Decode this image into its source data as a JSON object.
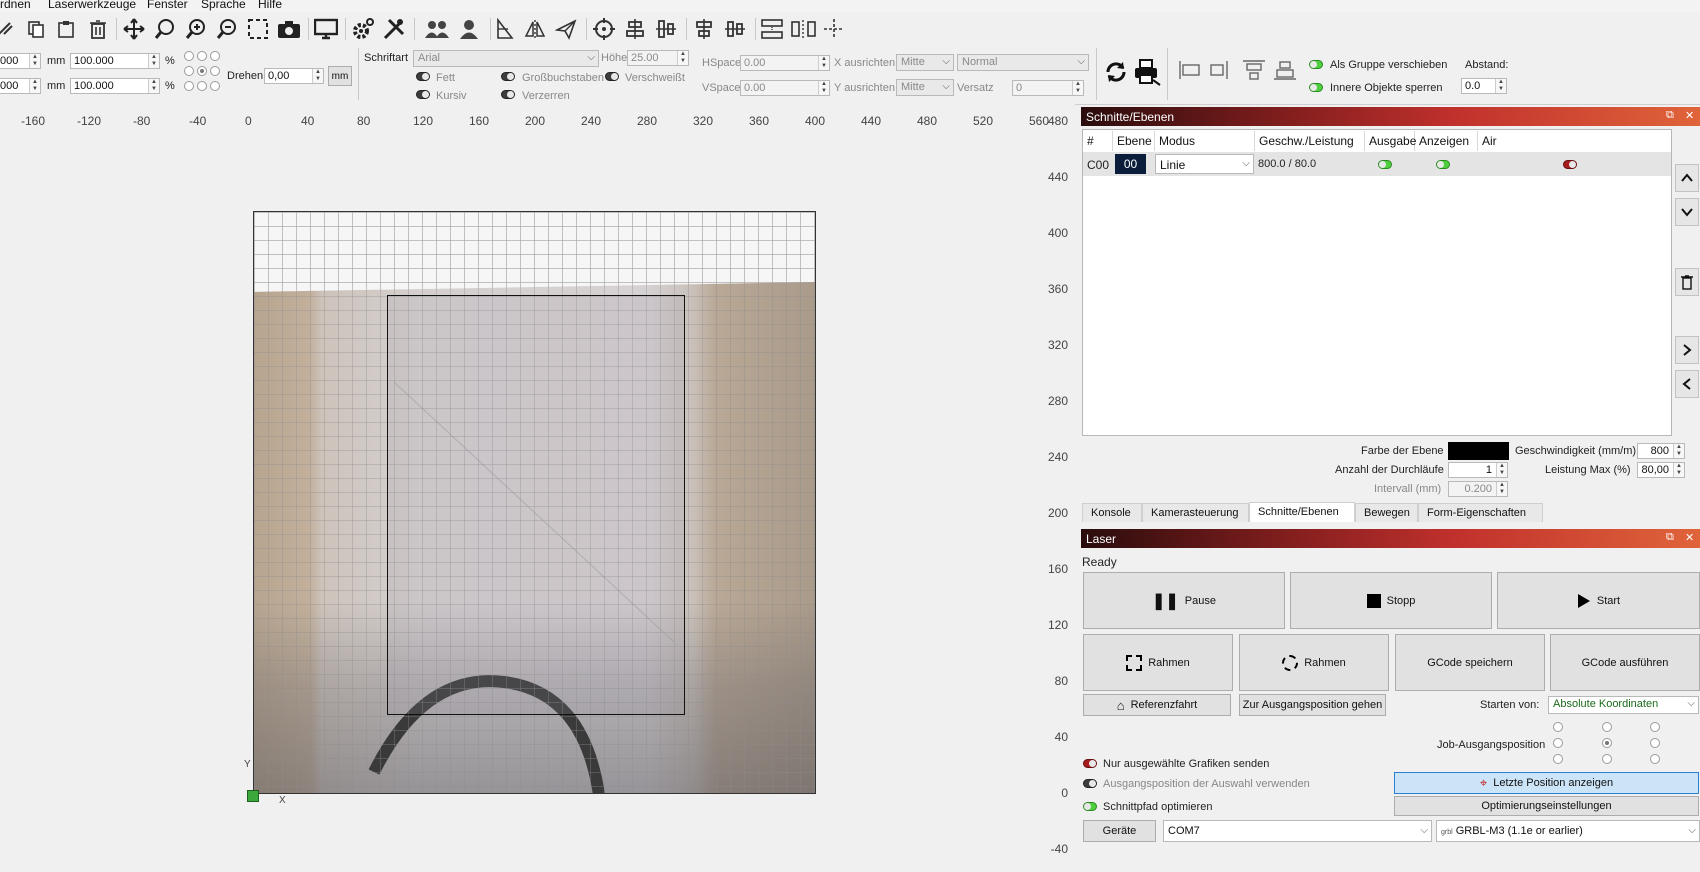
{
  "menu": [
    "rdnen",
    "Laserwerkzeuge",
    "Fenster",
    "Sprache",
    "Hilfe"
  ],
  "toolbar_icons": [
    "cut-icon",
    "copy-icon",
    "paste-icon",
    "delete-icon",
    "move-icon",
    "zoom-page-icon",
    "zoom-in-icon",
    "zoom-out-icon",
    "select-frame-icon",
    "camera-icon",
    "monitor-icon",
    "settings-icon",
    "tools-icon",
    "group-icon",
    "user-icon",
    "align-icon",
    "mirror-icon",
    "send-icon",
    "target-icon",
    "distribute-icon",
    "center-icon",
    "align-vert-icon",
    "align-horz-icon",
    "spacing-icon",
    "spacing2-icon",
    "crosshair-icon"
  ],
  "props": {
    "pos_x": "000",
    "pos_y": "000",
    "unit_mm": "mm",
    "width": "100.000",
    "height": "100.000",
    "pct": "%",
    "drehen_label": "Drehen",
    "drehen_value": "0,00",
    "mm_button": "mm",
    "schriftart_label": "Schriftart",
    "font_value": "Arial",
    "hoehe_label": "Höhe",
    "hoehe_value": "25.00",
    "fett": "Fett",
    "kursiv": "Kursiv",
    "gross": "Großbuchstaben",
    "verzerren": "Verzerren",
    "verschweisst": "Verschweißt",
    "hspace_label": "HSpace",
    "hspace_value": "0.00",
    "vspace_label": "VSpace",
    "vspace_value": "0.00",
    "x_ausrichten_label": "X ausrichten",
    "x_ausrichten_value": "Mitte",
    "normal_value": "Normal",
    "y_ausrichten_label": "Y ausrichten",
    "y_ausrichten_value": "Mitte",
    "versatz_label": "Versatz",
    "versatz_value": "0",
    "als_gruppe": "Als Gruppe verschieben",
    "innere_objekte": "Innere Objekte sperren",
    "abstand_label": "Abstand:",
    "abstand_value": "0.0"
  },
  "ruler_h": [
    "-160",
    "-120",
    "-80",
    "-40",
    "0",
    "40",
    "80",
    "120",
    "160",
    "200",
    "240",
    "280",
    "320",
    "360",
    "400",
    "440",
    "480",
    "520",
    "560"
  ],
  "ruler_v": [
    "480",
    "440",
    "400",
    "360",
    "320",
    "280",
    "240",
    "200",
    "160",
    "120",
    "80",
    "40",
    "0",
    "-40"
  ],
  "axis_labels": {
    "x": "X",
    "y": "Y"
  },
  "cuts": {
    "title": "Schnitte/Ebenen",
    "headers": [
      "#",
      "Ebene",
      "Modus",
      "Geschw./Leistung",
      "Ausgabe",
      "Anzeigen",
      "Air"
    ],
    "rows": [
      {
        "id": "C00",
        "layer": "00",
        "mode": "Linie",
        "speed_power": "800.0 / 80.0"
      }
    ],
    "farbe_label": "Farbe der Ebene",
    "layer_color": "#000000",
    "geschw_label": "Geschwindigkeit (mm/m)",
    "geschw_value": "800",
    "durchlaeufe_label": "Anzahl der Durchläufe",
    "durchlaeufe_value": "1",
    "leistung_label": "Leistung Max (%)",
    "leistung_value": "80,00",
    "intervall_label": "Intervall (mm)",
    "intervall_value": "0.200"
  },
  "tabs": [
    "Konsole",
    "Kamerasteuerung",
    "Schnitte/Ebenen",
    "Bewegen",
    "Form-Eigenschaften"
  ],
  "laser": {
    "title": "Laser",
    "status": "Ready",
    "pause": "Pause",
    "stopp": "Stopp",
    "start": "Start",
    "rahmen1": "Rahmen",
    "rahmen2": "Rahmen",
    "gcode_speichern": "GCode speichern",
    "gcode_ausfuehren": "GCode ausführen",
    "referenzfahrt": "Referenzfahrt",
    "ausgangsposition": "Zur Ausgangsposition gehen",
    "starten_von_label": "Starten von:",
    "starten_von_value": "Absolute Koordinaten",
    "job_label": "Job-Ausgangsposition",
    "nur_ausgewaehlte": "Nur ausgewählte Grafiken senden",
    "ausgangsposition_auswahl": "Ausgangsposition der Auswahl verwenden",
    "schnittpfad": "Schnittpfad optimieren",
    "letzte_position": "Letzte Position anzeigen",
    "optimierung": "Optimierungseinstellungen",
    "geraete": "Geräte",
    "port": "COM7",
    "device": "GRBL-M3 (1.1e or earlier)"
  },
  "colors": {
    "accent_green": "#4fcf3e",
    "title_grad_start": "#2a0c0c",
    "title_grad_end": "#e0643a",
    "selected_blue": "#cce4f7"
  }
}
